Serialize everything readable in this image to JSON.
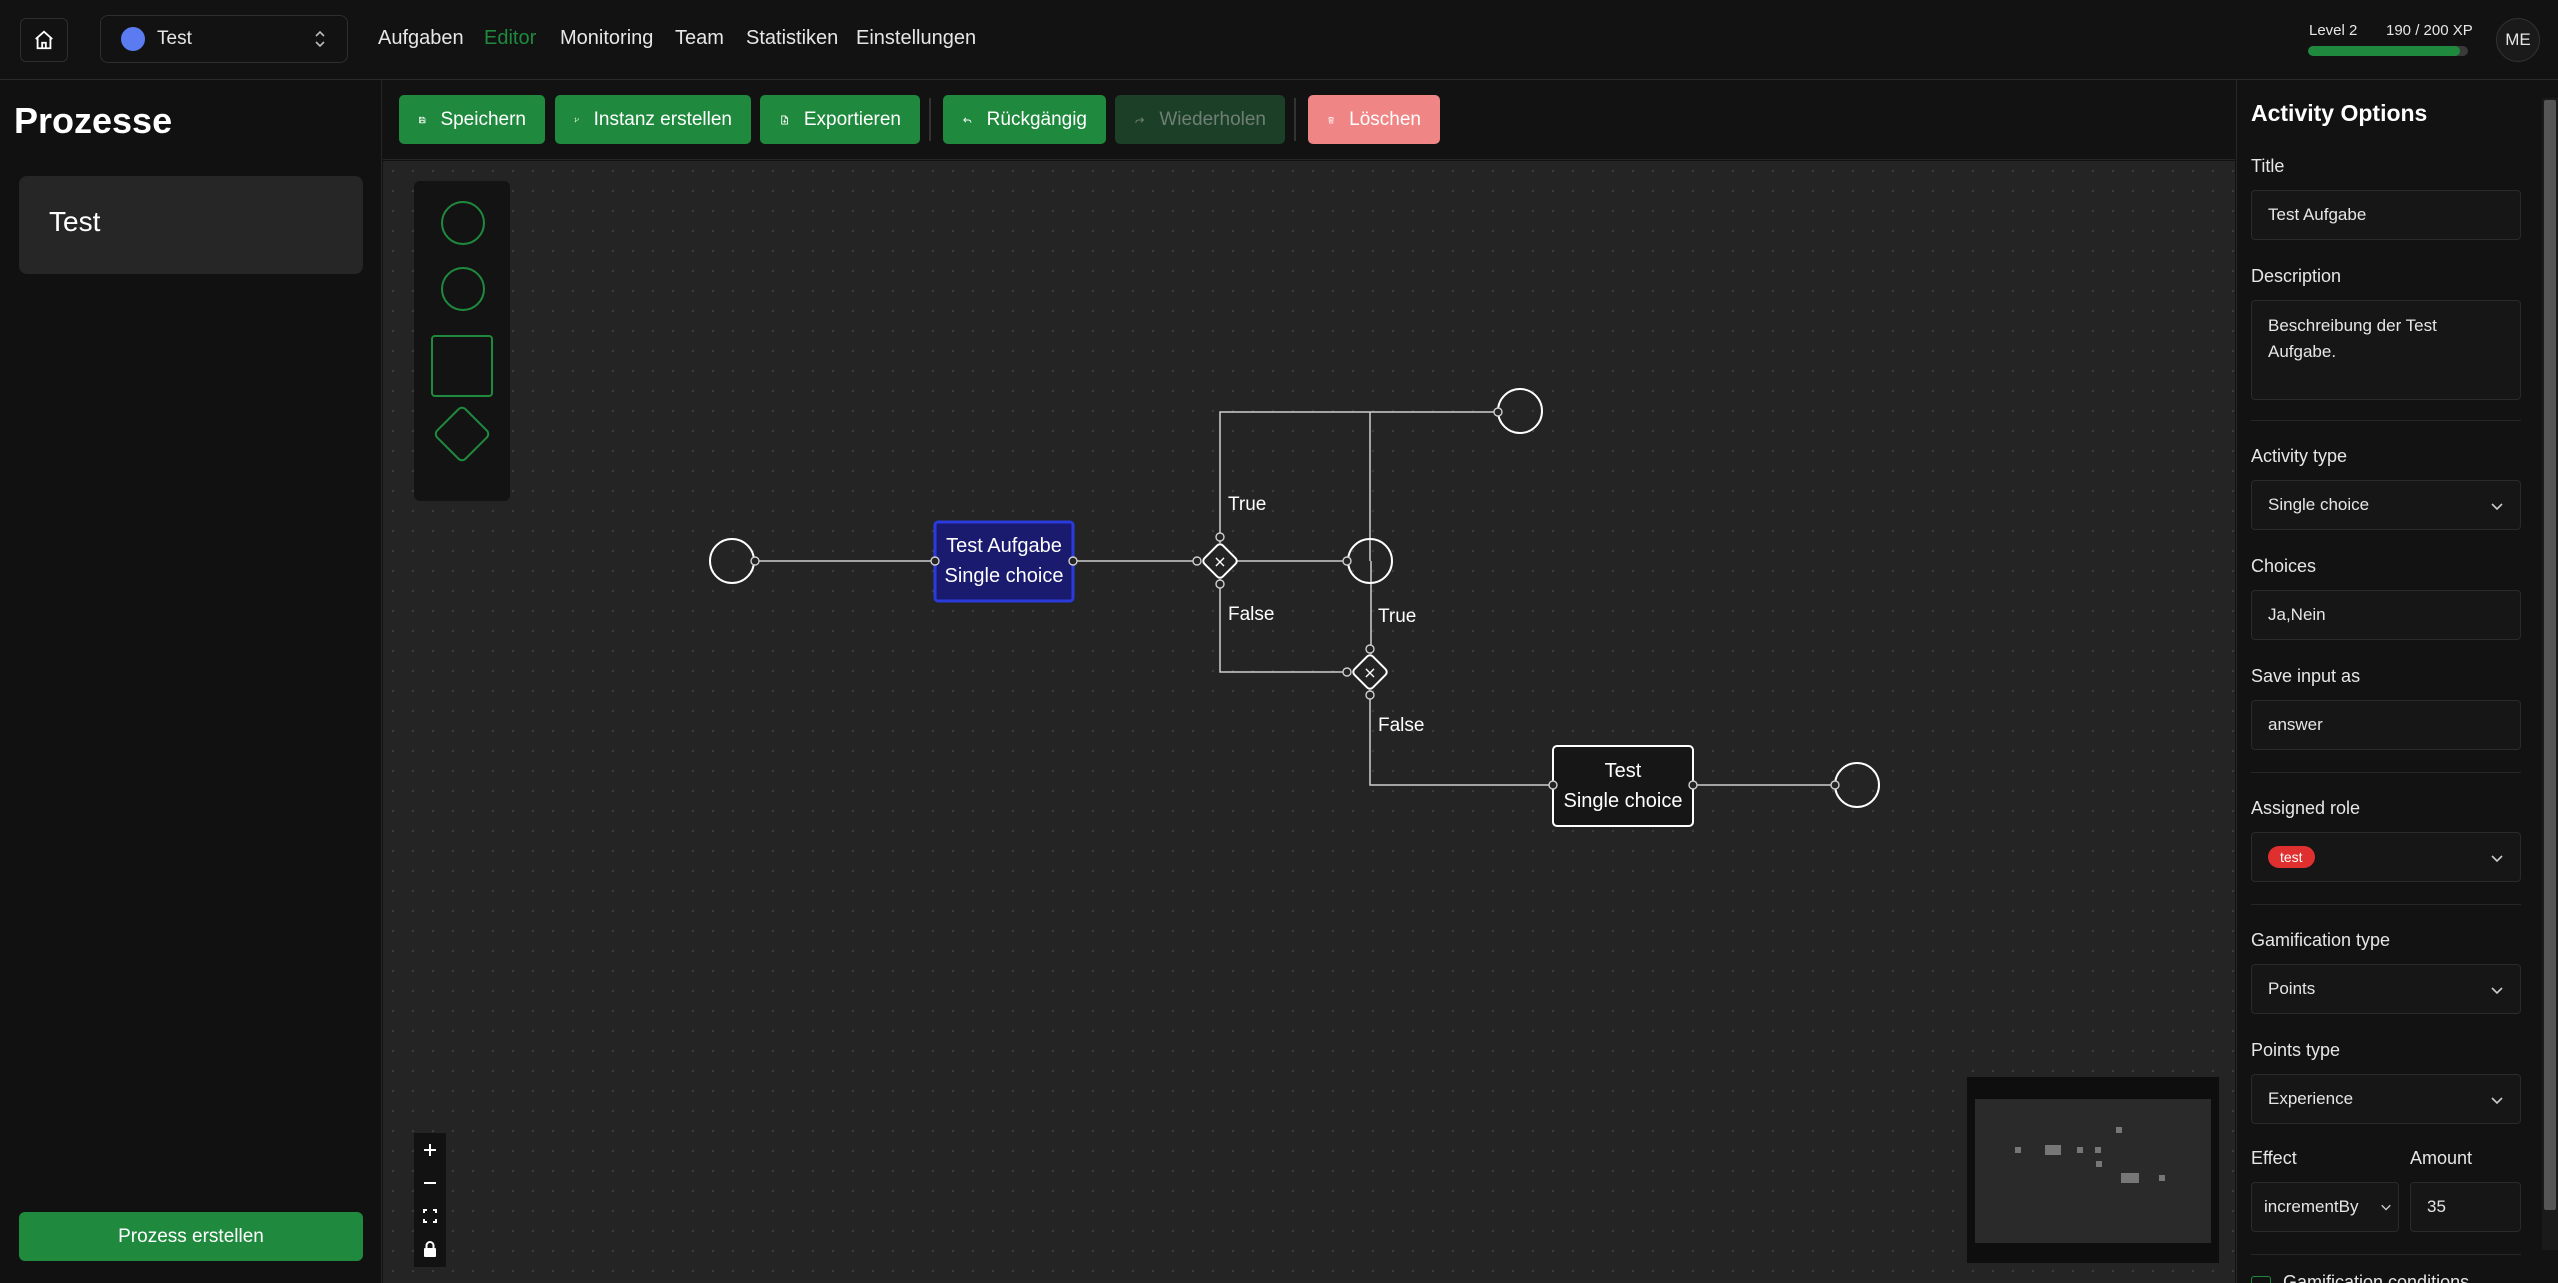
{
  "nav": {
    "project": "Test",
    "links": [
      "Aufgaben",
      "Editor",
      "Monitoring",
      "Team",
      "Statistiken",
      "Einstellungen"
    ],
    "active": "Editor",
    "level": "Level 2",
    "xp": "190 / 200 XP",
    "xp_progress": 0.95,
    "avatar": "ME"
  },
  "sidebar": {
    "title": "Prozesse",
    "items": [
      "Test"
    ],
    "create_label": "Prozess erstellen"
  },
  "toolbar": {
    "save": "Speichern",
    "create_instance": "Instanz erstellen",
    "export": "Exportieren",
    "undo": "Rückgängig",
    "redo": "Wiederholen",
    "delete": "Löschen"
  },
  "flow": {
    "task1": {
      "title": "Test Aufgabe",
      "type": "Single choice"
    },
    "task2": {
      "title": "Test",
      "type": "Single choice"
    },
    "edge_labels": {
      "true1": "True",
      "false1": "False",
      "true2": "True",
      "false2": "False"
    },
    "gateway_symbol": "×"
  },
  "panel": {
    "title": "Activity Options",
    "title_label": "Title",
    "title_value": "Test Aufgabe",
    "description_label": "Description",
    "description_value": "Beschreibung der Test Aufgabe.",
    "activity_type_label": "Activity type",
    "activity_type_value": "Single choice",
    "choices_label": "Choices",
    "choices_value": "Ja,Nein",
    "save_input_label": "Save input as",
    "save_input_value": "answer",
    "assigned_role_label": "Assigned role",
    "assigned_role_value": "test",
    "gamification_type_label": "Gamification type",
    "gamification_type_value": "Points",
    "points_type_label": "Points type",
    "points_type_value": "Experience",
    "effect_label": "Effect",
    "effect_value": "incrementBy",
    "amount_label": "Amount",
    "amount_value": "35",
    "next_label": "Gamification conditions"
  },
  "colors": {
    "accent": "#1f8a3e",
    "danger": "#f08585",
    "role_chip": "#e02f2f",
    "selected_node": "#1a1a6e"
  }
}
